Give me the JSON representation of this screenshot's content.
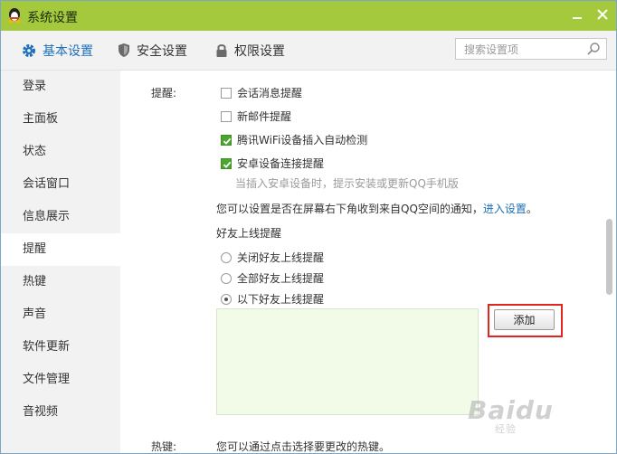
{
  "window": {
    "title": "系统设置"
  },
  "tabs": [
    {
      "label": "基本设置",
      "active": true
    },
    {
      "label": "安全设置",
      "active": false
    },
    {
      "label": "权限设置",
      "active": false
    }
  ],
  "search": {
    "placeholder": "搜索设置项"
  },
  "sidebar": {
    "items": [
      {
        "label": "登录"
      },
      {
        "label": "主面板"
      },
      {
        "label": "状态"
      },
      {
        "label": "会话窗口"
      },
      {
        "label": "信息展示"
      },
      {
        "label": "提醒",
        "active": true
      },
      {
        "label": "热键"
      },
      {
        "label": "声音"
      },
      {
        "label": "软件更新"
      },
      {
        "label": "文件管理"
      },
      {
        "label": "音视频"
      }
    ]
  },
  "reminders": {
    "label": "提醒:",
    "options": [
      {
        "label": "会话消息提醒",
        "checked": false
      },
      {
        "label": "新邮件提醒",
        "checked": false
      },
      {
        "label": "腾讯WiFi设备插入自动检测",
        "checked": true
      },
      {
        "label": "安卓设备连接提醒",
        "checked": true
      }
    ],
    "android_hint": "当插入安卓设备时，提示安装或更新QQ手机版",
    "qzone_notice": "您可以设置是否在屏幕右下角收到来自QQ空间的通知，",
    "qzone_link": "进入设置",
    "qzone_end": "。"
  },
  "friend_online": {
    "title": "好友上线提醒",
    "options": [
      {
        "label": "关闭好友上线提醒",
        "checked": false
      },
      {
        "label": "全部好友上线提醒",
        "checked": false
      },
      {
        "label": "以下好友上线提醒",
        "checked": true
      }
    ],
    "add_label": "添加"
  },
  "hotkeys": {
    "label": "热键:",
    "text": "您可以通过点击选择要更改的热键。"
  },
  "colors": {
    "titlebar": "#a5c93d",
    "accent": "#1e6fba",
    "checked": "#4aa62f",
    "highlight": "#e0261f"
  },
  "watermark": {
    "text": "Baidu",
    "sub": "经验"
  }
}
